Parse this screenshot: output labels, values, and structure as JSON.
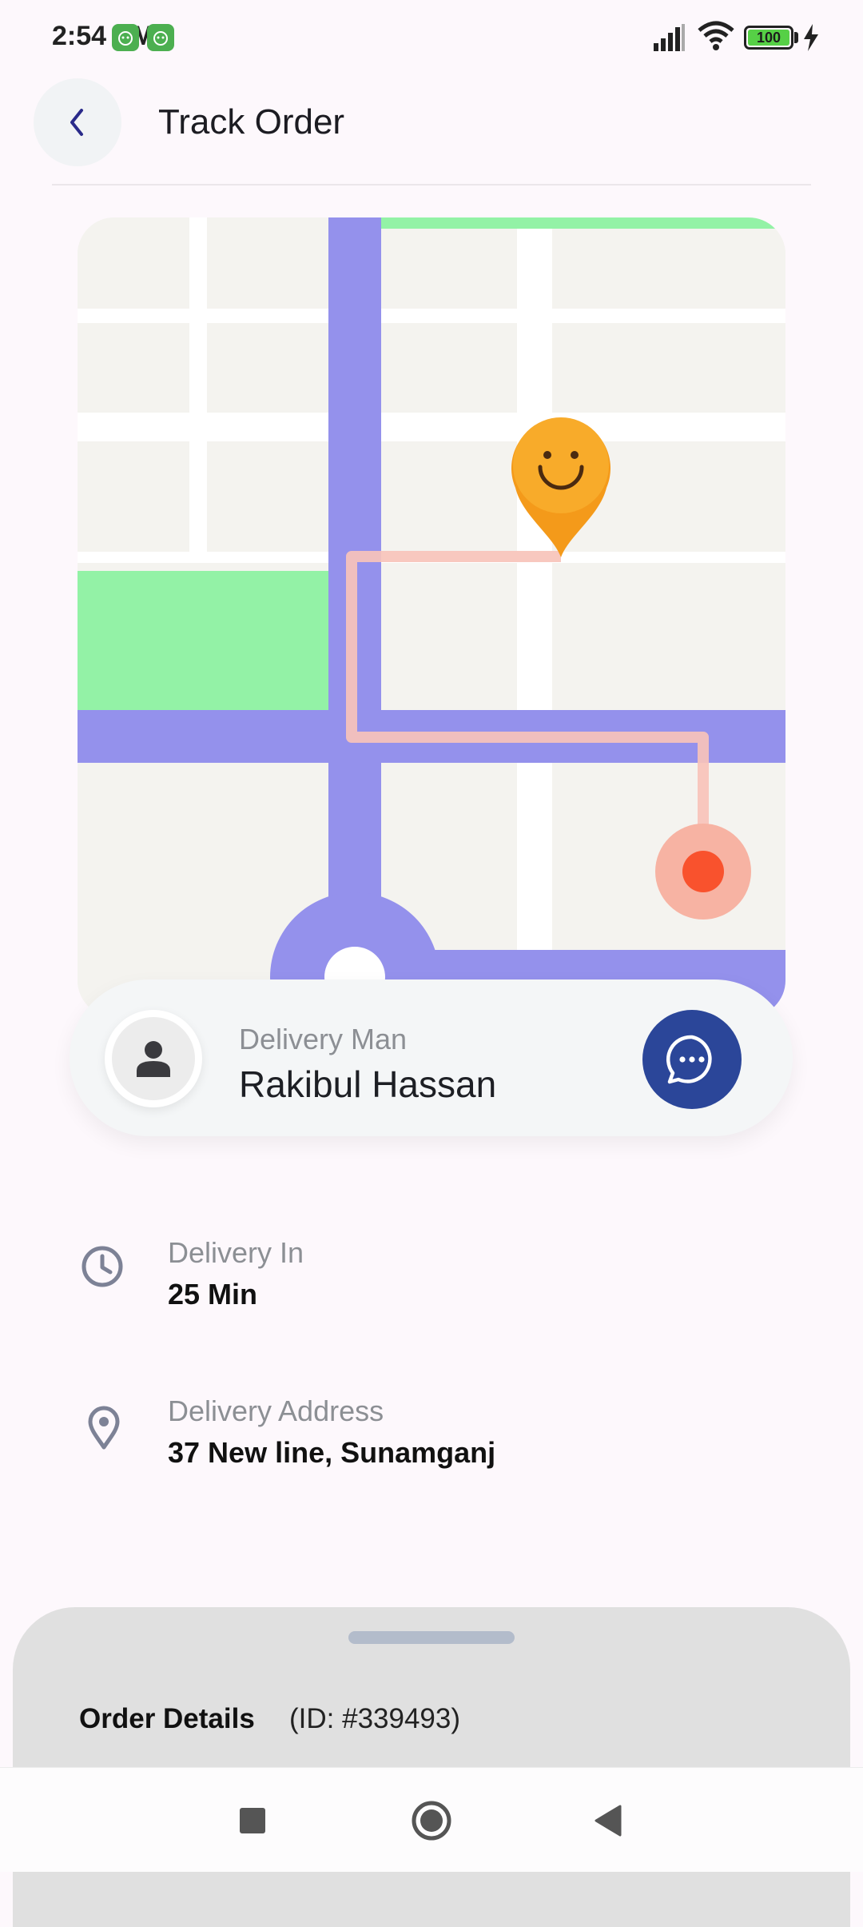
{
  "status_bar": {
    "time": "2:54 PM",
    "battery": "100",
    "icons": [
      "android-app-icon",
      "android-app-icon",
      "signal-icon",
      "wifi-icon",
      "battery-icon",
      "charging-icon"
    ]
  },
  "header": {
    "title": "Track Order",
    "back_icon": "chevron-left-icon"
  },
  "map": {
    "markers": [
      "smiley-destination-pin-icon",
      "current-location-dot-icon"
    ],
    "colors": {
      "road": "#9491ec",
      "park": "#93f2a6",
      "route": "#f7c3ba",
      "pin": "#f49a1a",
      "dot": "#f9522d"
    }
  },
  "driver": {
    "label": "Delivery Man",
    "name": "Rakibul Hassan",
    "avatar_icon": "person-icon",
    "chat_icon": "chat-bubble-icon"
  },
  "delivery_time": {
    "label": "Delivery In",
    "value": "25 Min",
    "icon": "clock-icon"
  },
  "delivery_address": {
    "label": "Delivery Address",
    "value": "37 New line, Sunamganj",
    "icon": "location-pin-icon"
  },
  "order_sheet": {
    "title": "Order Details",
    "id_text": "(ID: #339493)"
  },
  "nav_bar": {
    "buttons": [
      "recents-square-icon",
      "home-circle-icon",
      "back-triangle-icon"
    ]
  },
  "colors": {
    "accent": "#2b4699",
    "background": "#fdf8fc",
    "muted_text": "#8c8f94"
  }
}
